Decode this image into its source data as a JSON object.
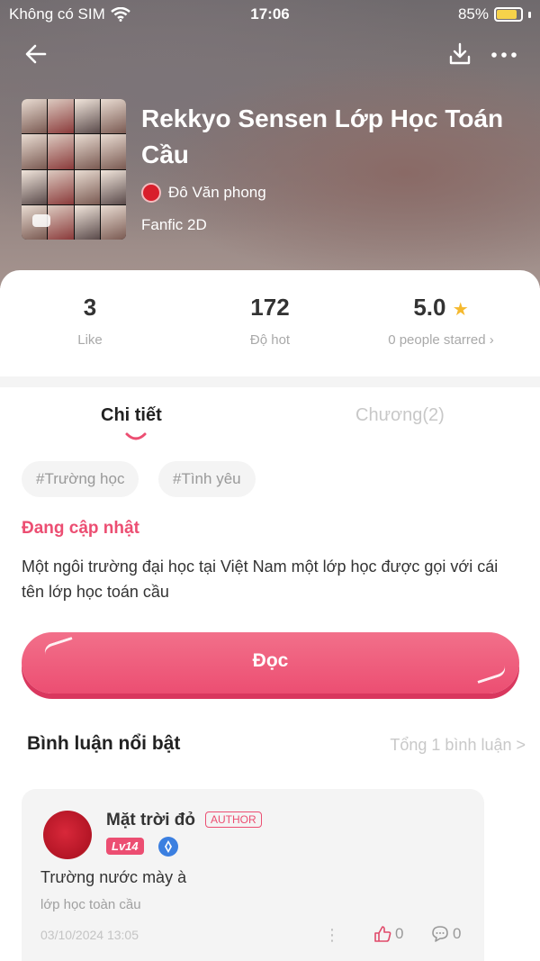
{
  "status_bar": {
    "carrier": "Không có SIM",
    "time": "17:06",
    "battery": "85%",
    "battery_level": 0.85
  },
  "header": {
    "back_icon": "arrow-left-icon",
    "download_icon": "download-icon",
    "more_icon": "more-horizontal-icon"
  },
  "book": {
    "title": "Rekkyo Sensen Lớp Học Toán Cầu",
    "author": "Đô Văn phong",
    "genre": "Fanfic 2D"
  },
  "stats": {
    "likes": "3",
    "likes_label": "Like",
    "hot": "172",
    "hot_label": "Độ hot",
    "rating": "5.0",
    "rating_label": "0 people starred ›"
  },
  "tabs": {
    "detail": "Chi tiết",
    "chapters": "Chương(2)"
  },
  "tags": [
    "#Trường học",
    "#Tình yêu"
  ],
  "status_heading": "Đang cập nhật",
  "description": "Một ngôi trường đại học tại Việt Nam một lớp học được gọi với cái tên lớp học toán cầu",
  "read_button": "Đọc",
  "comments": {
    "title": "Bình luận nổi bật",
    "total": "Tổng 1 bình luận >",
    "items": [
      {
        "name": "Mặt trời đỏ",
        "badge": "AUTHOR",
        "level": "Lv14",
        "text": "Trường nước mày à",
        "sub": "lớp học toàn cầu",
        "date": "03/10/2024 13:05",
        "likes": "0",
        "replies": "0"
      }
    ]
  },
  "colors": {
    "accent": "#ec4e72",
    "star": "#f5b92e"
  }
}
